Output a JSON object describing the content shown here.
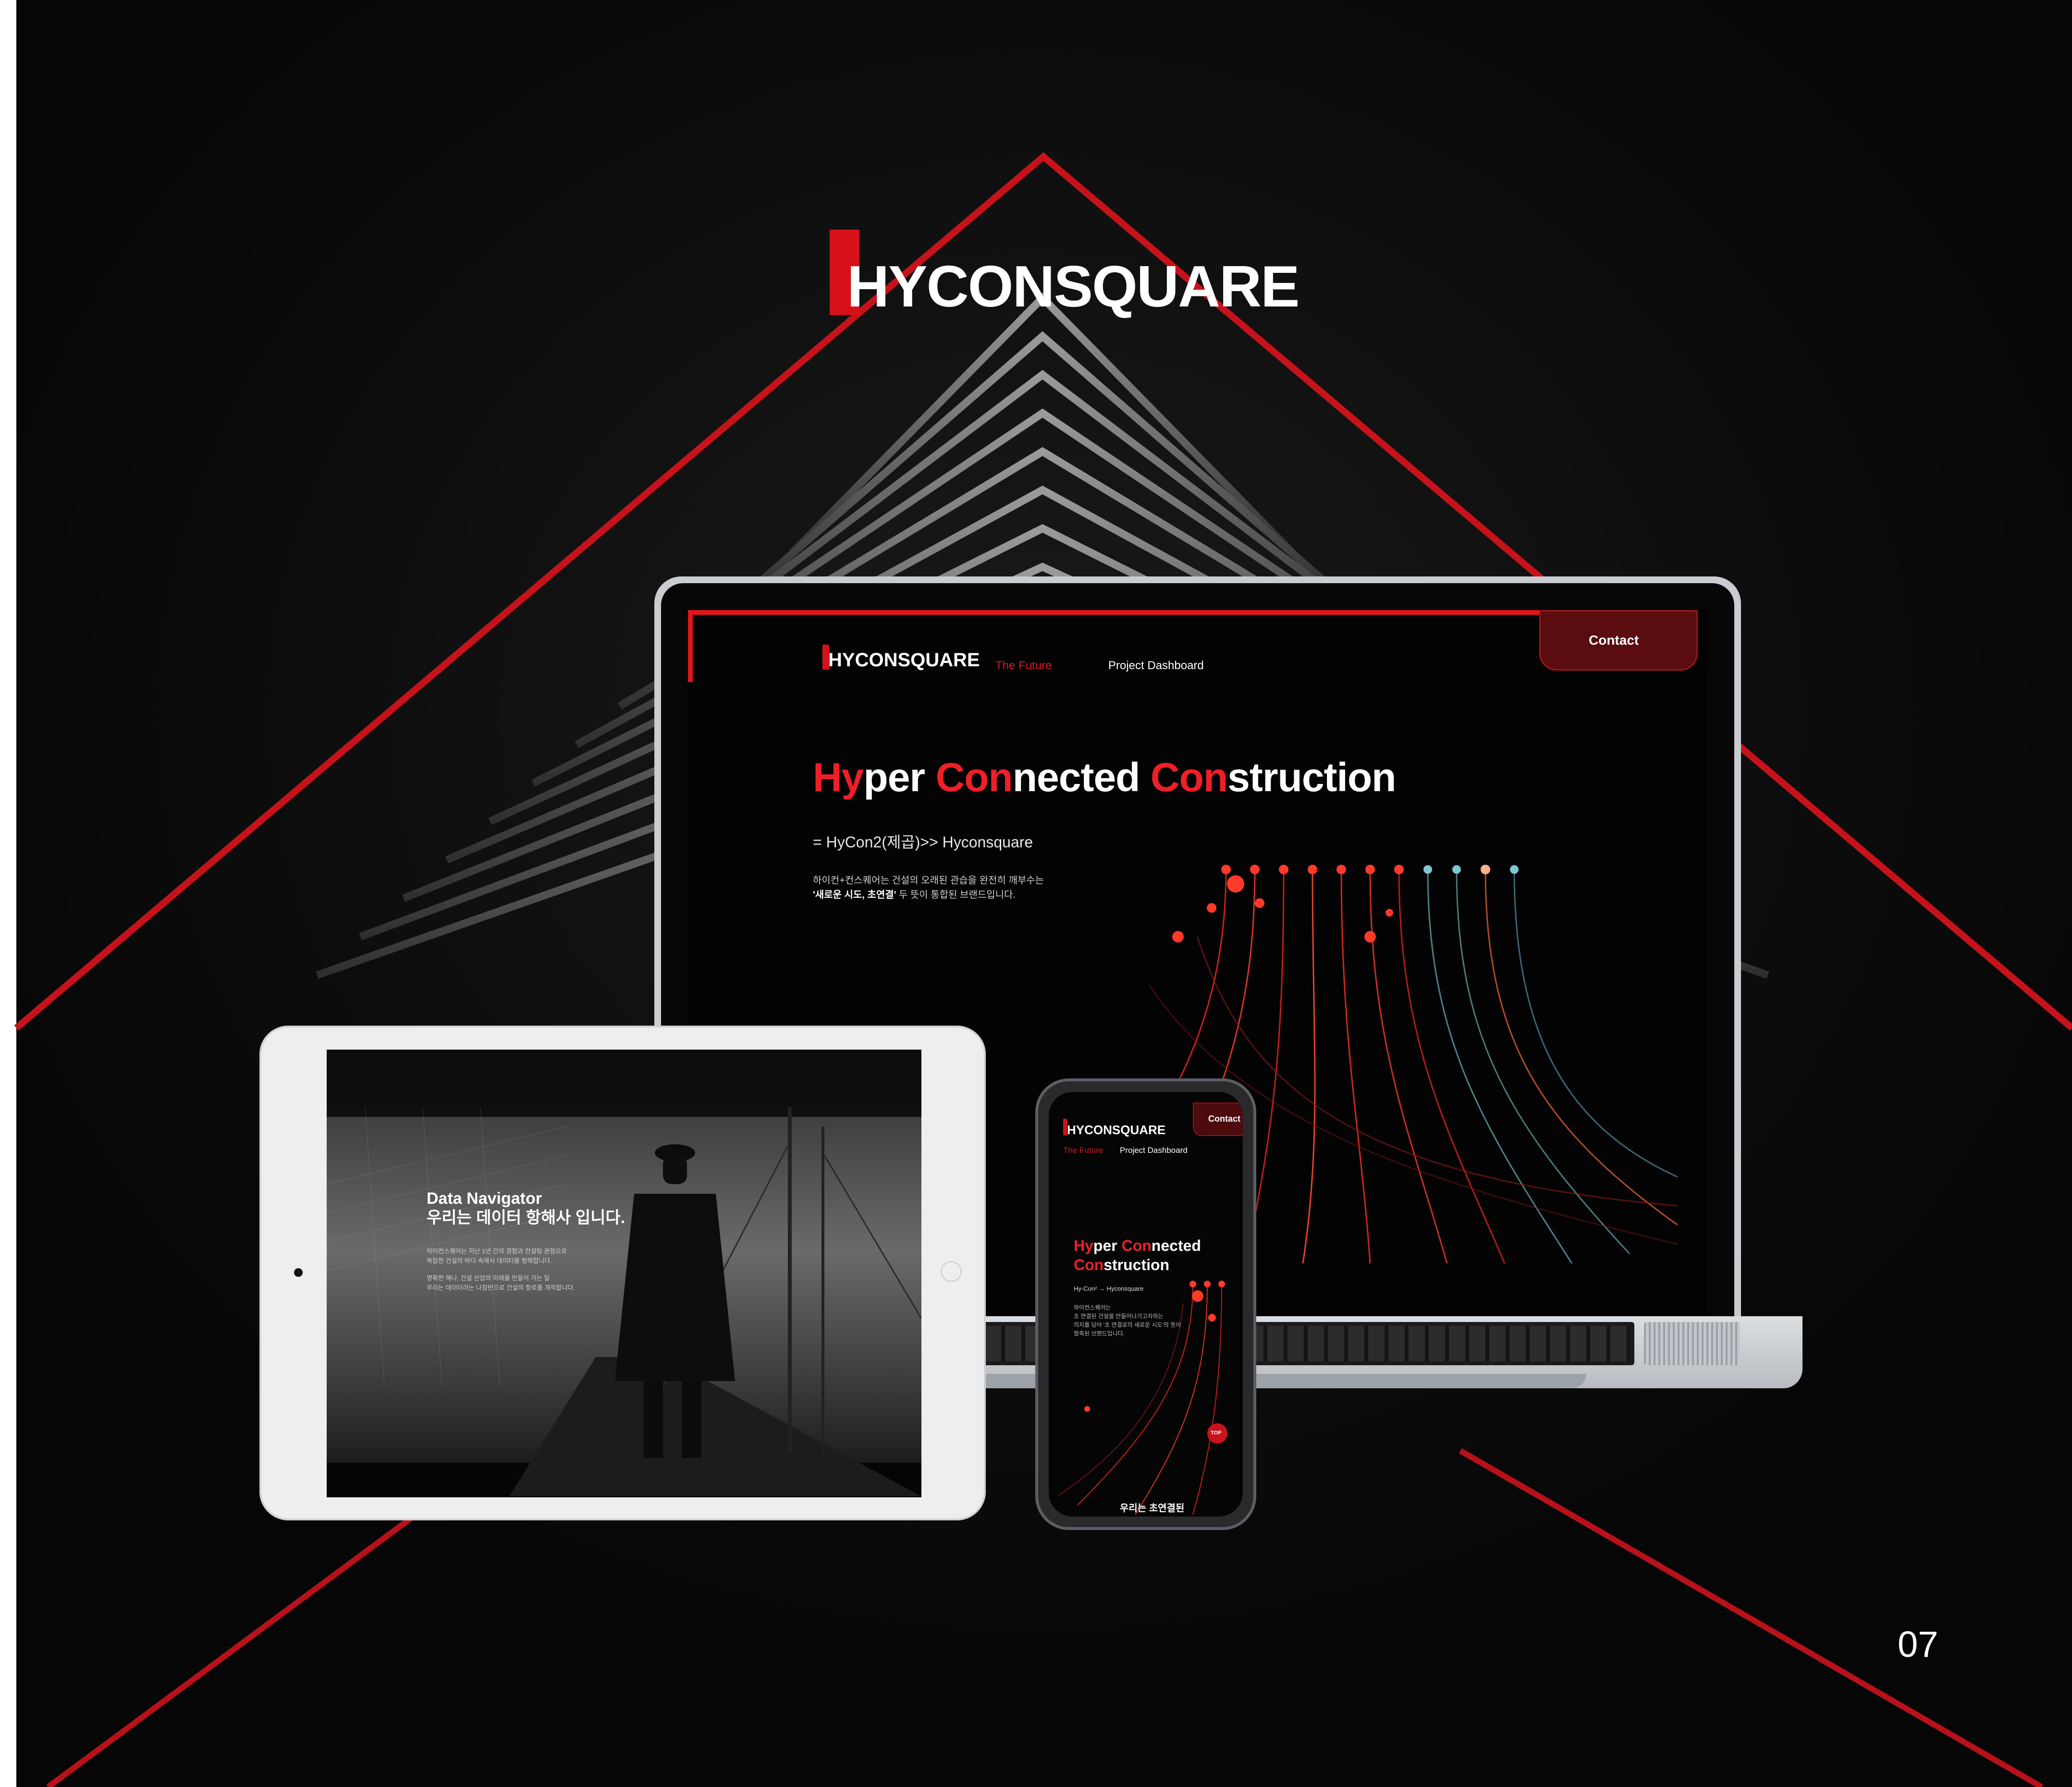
{
  "brand": {
    "logo": "HYCONSQUARE",
    "accent_color": "#e0141b",
    "background_color": "#080808"
  },
  "page_number": "07",
  "desktop": {
    "nav": {
      "future": "The Future",
      "dashboard": "Project Dashboard",
      "contact": "Contact"
    },
    "hero": {
      "title_parts": [
        "Hy",
        "per ",
        "Con",
        "nected ",
        "Con",
        "struction"
      ],
      "subtitle": "= HyCon2(제곱)>> Hyconsquare",
      "desc_line1": "하이컨+컨스퀘어는 건설의 오래된 관습을 완전히 깨부수는",
      "desc_line2_bold": "'새로운 시도, 초연결'",
      "desc_line2_rest": " 두 뜻이 통합된 브랜드입니다."
    }
  },
  "tablet": {
    "title_line1": "Data Navigator",
    "title_line2": "우리는 데이터 항해사 입니다.",
    "desc": [
      "하이컨스퀘어는 지난 1년 간의 경험과 컨설팅 관점으로",
      "복잡한 건설의 바다 속에서 데이터를 항해합니다.",
      "명확한 해나, 건설 산업의 미래를 만들어 가는 일",
      "우리는 데이터라는 나침반으로 건설의 항로를 개척합니다."
    ]
  },
  "mobile": {
    "nav": {
      "future": "The Future",
      "dashboard": "Project Dashboard",
      "contact": "Contact"
    },
    "hero": {
      "line1_parts": [
        "Hy",
        "per ",
        "Con",
        "nected"
      ],
      "line2_parts": [
        "Con",
        "struction"
      ],
      "subtitle": "Hy-Con² → Hyconsquare",
      "desc": [
        "하이컨스퀘어는",
        "초 연결된 건설을 만들어나가고자하는",
        "의지를 담아 '초 연결로의 새로운 시도'의 뜻이",
        "함축된 브랜드입니다."
      ]
    },
    "top_button": "TOP",
    "bottom_text": "우리는 초연결된"
  },
  "icons": [
    "logo-mark-icon",
    "tablet-camera-icon",
    "tablet-home-button-icon",
    "phone-top-button-icon"
  ]
}
